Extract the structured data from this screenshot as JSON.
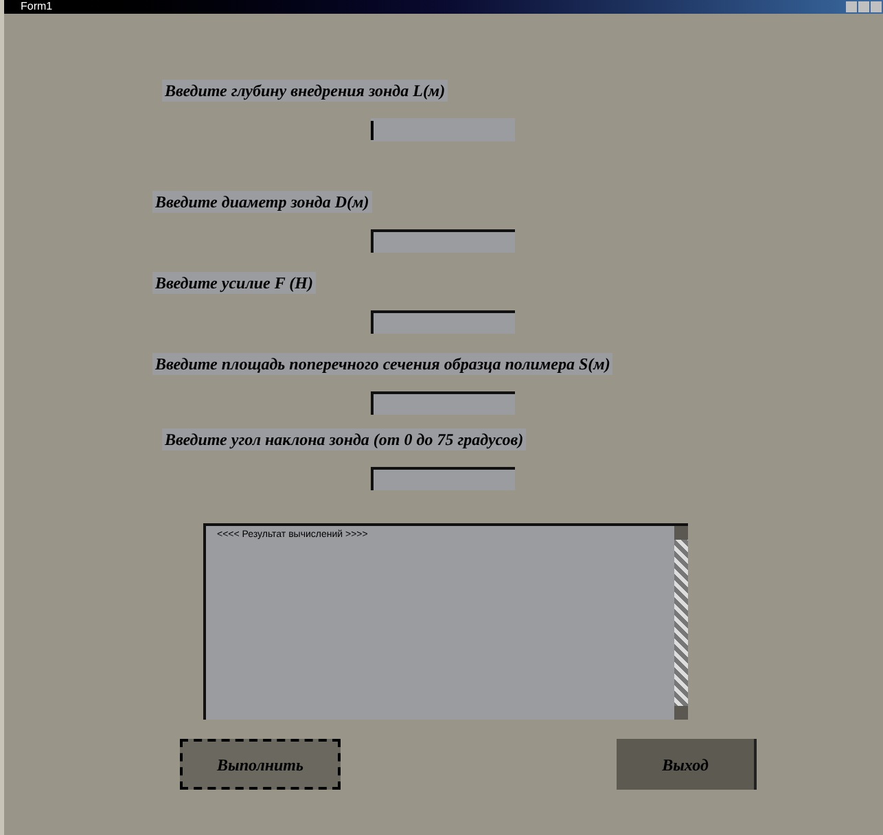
{
  "window": {
    "title": "Form1"
  },
  "fields": [
    {
      "label": "Введите глубину внедрения зонда L(м)",
      "focused": true
    },
    {
      "label": "Введите диаметр зонда D(м)",
      "focused": false
    },
    {
      "label": "Введите усилие F (Н)",
      "focused": false
    },
    {
      "label": "Введите площадь поперечного сечения образца полимера S(м)",
      "focused": false
    },
    {
      "label": "Введите угол наклона зонда (от 0 до 75 градусов)",
      "focused": false
    }
  ],
  "output": {
    "text": "<<<< Результат вычислений >>>>"
  },
  "buttons": [
    {
      "label": "Выполнить",
      "focused": true
    },
    {
      "label": "Выход",
      "focused": false
    }
  ]
}
